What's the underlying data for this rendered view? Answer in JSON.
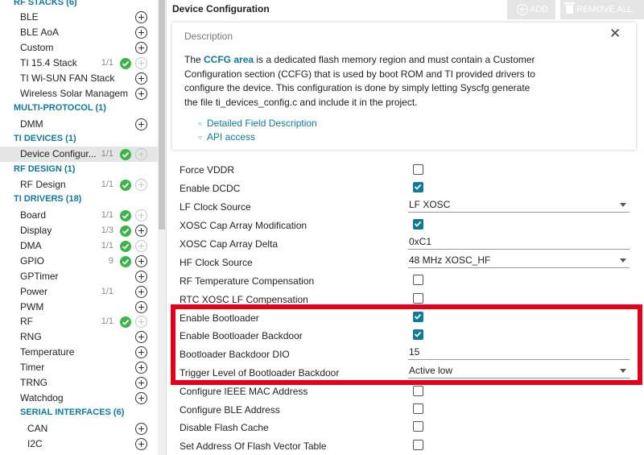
{
  "sidebar": {
    "rf_stacks": "RF STACKS (6)",
    "ble": "BLE",
    "ble_aoa": "BLE AoA",
    "custom": "Custom",
    "ti154": "TI 15.4 Stack",
    "ti154_count": "1/1",
    "wisun": "TI Wi-SUN FAN Stack",
    "wireless_solar": "Wireless Solar Managem...",
    "multi_protocol": "MULTI-PROTOCOL (1)",
    "dmm": "DMM",
    "ti_devices": "TI DEVICES (1)",
    "device_config": "Device Configur...",
    "device_config_count": "1/1",
    "rf_design_cat": "RF DESIGN (1)",
    "rf_design": "RF Design",
    "rf_design_count": "1/1",
    "ti_drivers": "TI DRIVERS (18)",
    "board": "Board",
    "board_count": "1/1",
    "display": "Display",
    "display_count": "1/3",
    "dma": "DMA",
    "dma_count": "1/1",
    "gpio": "GPIO",
    "gpio_count": "9",
    "gptimer": "GPTimer",
    "power": "Power",
    "power_count": "1/1",
    "pwm": "PWM",
    "rf": "RF",
    "rf_count": "1/1",
    "rng": "RNG",
    "temperature": "Temperature",
    "timer": "Timer",
    "trng": "TRNG",
    "watchdog": "Watchdog",
    "serial_interfaces": "SERIAL INTERFACES (6)",
    "can": "CAN",
    "i2c": "I2C"
  },
  "header": {
    "title": "Device Configuration",
    "add_label": "ADD",
    "remove_all_label": "REMOVE ALL"
  },
  "description": {
    "title": "Description",
    "close": "✕",
    "p1_pre": "The ",
    "p1_bold": "CCFG area",
    "p1_post": " is a dedicated flash memory region and must contain a Customer Configuration section (CCFG) that is used by boot ROM and TI provided drivers to configure the device. This configuration is done by simply letting Syscfg generate the file ti_devices_config.c and include it in the project.",
    "link1": "Detailed Field Description",
    "link2": "API access"
  },
  "config": {
    "force_vddr": "Force VDDR",
    "enable_dcdc": "Enable DCDC",
    "lf_clock_source": "LF Clock Source",
    "lf_clock_value": "LF XOSC",
    "xosc_cap_mod": "XOSC Cap Array Modification",
    "xosc_cap_delta": "XOSC Cap Array Delta",
    "xosc_cap_delta_value": "0xC1",
    "hf_clock_source": "HF Clock Source",
    "hf_clock_value": "48 MHz XOSC_HF",
    "rf_temp_comp": "RF Temperature Compensation",
    "rtc_xosc_lf_comp": "RTC XOSC LF Compensation",
    "enable_bootloader": "Enable Bootloader",
    "enable_bootloader_backdoor": "Enable Bootloader Backdoor",
    "bootloader_backdoor_dio": "Bootloader Backdoor DIO",
    "bootloader_backdoor_dio_value": "15",
    "trigger_level": "Trigger Level of Bootloader Backdoor",
    "trigger_level_value": "Active low",
    "configure_ieee_mac": "Configure IEEE MAC Address",
    "configure_ble_address": "Configure BLE Address",
    "disable_flash_cache": "Disable Flash Cache",
    "set_flash_vector": "Set Address Of Flash Vector Table"
  },
  "colors": {
    "accent": "#117a94",
    "check_green": "#3bb54a",
    "highlight_red": "#e3001b"
  }
}
